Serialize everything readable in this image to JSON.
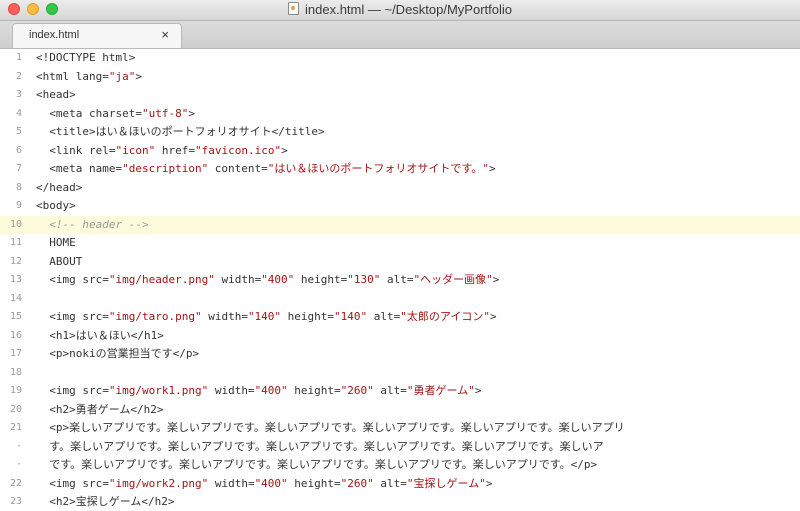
{
  "window": {
    "title": "index.html — ~/Desktop/MyPortfolio"
  },
  "tabs": [
    {
      "label": "index.html",
      "close": "×"
    }
  ],
  "editor": {
    "active_line": 10,
    "lines": [
      {
        "num": "1",
        "text": "<!DOCTYPE html>"
      },
      {
        "num": "2",
        "text": "<html lang=\"ja\">"
      },
      {
        "num": "3",
        "text": "<head>"
      },
      {
        "num": "4",
        "text": "  <meta charset=\"utf-8\">"
      },
      {
        "num": "5",
        "text": "  <title>はい＆ほいのポートフォリオサイト</title>"
      },
      {
        "num": "6",
        "text": "  <link rel=\"icon\" href=\"favicon.ico\">"
      },
      {
        "num": "7",
        "text": "  <meta name=\"description\" content=\"はい＆ほいのポートフォリオサイトです。\">"
      },
      {
        "num": "8",
        "text": "</head>"
      },
      {
        "num": "9",
        "text": "<body>"
      },
      {
        "num": "10",
        "text": "  <!-- header -->"
      },
      {
        "num": "11",
        "text": "  HOME"
      },
      {
        "num": "12",
        "text": "  ABOUT"
      },
      {
        "num": "13",
        "text": "  <img src=\"img/header.png\" width=\"400\" height=\"130\" alt=\"ヘッダー画像\">"
      },
      {
        "num": "14",
        "text": ""
      },
      {
        "num": "15",
        "text": "  <img src=\"img/taro.png\" width=\"140\" height=\"140\" alt=\"太郎のアイコン\">"
      },
      {
        "num": "16",
        "text": "  <h1>はい＆ほい</h1>"
      },
      {
        "num": "17",
        "text": "  <p>nokiの営業担当です</p>"
      },
      {
        "num": "18",
        "text": ""
      },
      {
        "num": "19",
        "text": "  <img src=\"img/work1.png\" width=\"400\" height=\"260\" alt=\"勇者ゲーム\">"
      },
      {
        "num": "20",
        "text": "  <h2>勇者ゲーム</h2>"
      },
      {
        "num": "21",
        "text": "  <p>楽しいアプリです。楽しいアプリです。楽しいアプリです。楽しいアプリです。楽しいアプリです。楽しいアプリ"
      },
      {
        "num": "·",
        "text": "  す。楽しいアプリです。楽しいアプリです。楽しいアプリです。楽しいアプリです。楽しいアプリです。楽しいア"
      },
      {
        "num": "·",
        "text": "  です。楽しいアプリです。楽しいアプリです。楽しいアプリです。楽しいアプリです。楽しいアプリです。</p>"
      },
      {
        "num": "22",
        "text": "  <img src=\"img/work2.png\" width=\"400\" height=\"260\" alt=\"宝探しゲーム\">"
      },
      {
        "num": "23",
        "text": "  <h2>宝探しゲーム</h2>"
      }
    ]
  },
  "colors": {
    "string": "#a31515",
    "comment": "#999999",
    "active_line_bg": "#fefbdd",
    "close_button": "#fc605b",
    "minimize_button": "#fdbc40",
    "maximize_button": "#34c84a"
  }
}
